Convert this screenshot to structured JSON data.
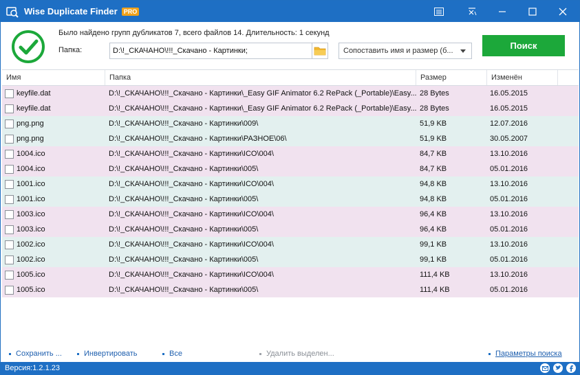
{
  "window": {
    "title": "Wise Duplicate Finder",
    "badge": "PRO"
  },
  "header": {
    "status": "Было найдено групп дубликатов 7, всего файлов 14. Длительность: 1 секунд",
    "folder_label": "Папка:",
    "folder_value": "D:\\!_СКАЧАНО\\!!!_Скачано - Картинки;",
    "match_mode": "Сопоставить имя и размер (б...",
    "search_label": "Поиск"
  },
  "table": {
    "columns": [
      "Имя",
      "Папка",
      "Размер",
      "Изменён"
    ],
    "rows": [
      {
        "name": "keyfile.dat",
        "path": "D:\\!_СКАЧАНО\\!!!_Скачано - Картинки\\_Easy GIF Animator 6.2 RePack (_Portable)\\Easy...",
        "size": "28 Bytes",
        "date": "16.05.2015"
      },
      {
        "name": "keyfile.dat",
        "path": "D:\\!_СКАЧАНО\\!!!_Скачано - Картинки\\_Easy GIF Animator 6.2 RePack (_Portable)\\Easy...",
        "size": "28 Bytes",
        "date": "16.05.2015"
      },
      {
        "name": "png.png",
        "path": "D:\\!_СКАЧАНО\\!!!_Скачано - Картинки\\009\\",
        "size": "51,9 KB",
        "date": "12.07.2016"
      },
      {
        "name": "png.png",
        "path": "D:\\!_СКАЧАНО\\!!!_Скачано - Картинки\\РАЗНОЕ\\06\\",
        "size": "51,9 KB",
        "date": "30.05.2007"
      },
      {
        "name": "1004.ico",
        "path": "D:\\!_СКАЧАНО\\!!!_Скачано - Картинки\\ICO\\004\\",
        "size": "84,7 KB",
        "date": "13.10.2016"
      },
      {
        "name": "1004.ico",
        "path": "D:\\!_СКАЧАНО\\!!!_Скачано - Картинки\\005\\",
        "size": "84,7 KB",
        "date": "05.01.2016"
      },
      {
        "name": "1001.ico",
        "path": "D:\\!_СКАЧАНО\\!!!_Скачано - Картинки\\ICO\\004\\",
        "size": "94,8 KB",
        "date": "13.10.2016"
      },
      {
        "name": "1001.ico",
        "path": "D:\\!_СКАЧАНО\\!!!_Скачано - Картинки\\005\\",
        "size": "94,8 KB",
        "date": "05.01.2016"
      },
      {
        "name": "1003.ico",
        "path": "D:\\!_СКАЧАНО\\!!!_Скачано - Картинки\\ICO\\004\\",
        "size": "96,4 KB",
        "date": "13.10.2016"
      },
      {
        "name": "1003.ico",
        "path": "D:\\!_СКАЧАНО\\!!!_Скачано - Картинки\\005\\",
        "size": "96,4 KB",
        "date": "05.01.2016"
      },
      {
        "name": "1002.ico",
        "path": "D:\\!_СКАЧАНО\\!!!_Скачано - Картинки\\ICO\\004\\",
        "size": "99,1 KB",
        "date": "13.10.2016"
      },
      {
        "name": "1002.ico",
        "path": "D:\\!_СКАЧАНО\\!!!_Скачано - Картинки\\005\\",
        "size": "99,1 KB",
        "date": "05.01.2016"
      },
      {
        "name": "1005.ico",
        "path": "D:\\!_СКАЧАНО\\!!!_Скачано - Картинки\\ICO\\004\\",
        "size": "111,4 KB",
        "date": "13.10.2016"
      },
      {
        "name": "1005.ico",
        "path": "D:\\!_СКАЧАНО\\!!!_Скачано - Картинки\\005\\",
        "size": "111,4 KB",
        "date": "05.01.2016"
      }
    ]
  },
  "footer": {
    "save": "Сохранить ...",
    "invert": "Инвертировать",
    "all": "Все",
    "delete_selected": "Удалить выделен...",
    "search_params": "Параметры поиска"
  },
  "statusbar": {
    "version": "Версия:1.2.1.23"
  },
  "colors": {
    "accent": "#1e6fc4",
    "search_button": "#1ca83a",
    "group_a": "#f1e2ef",
    "group_b": "#e3f0ef"
  },
  "icons": [
    "app-logo-icon",
    "menu-icon",
    "feedback-icon",
    "minimize-icon",
    "maximize-icon",
    "close-icon",
    "checkmark-icon",
    "folder-icon",
    "mail-icon",
    "twitter-icon",
    "facebook-icon"
  ]
}
